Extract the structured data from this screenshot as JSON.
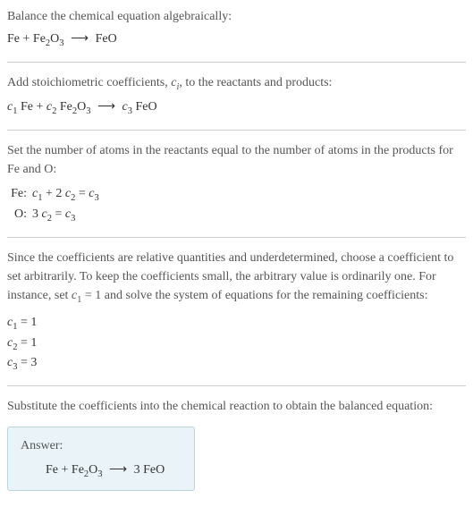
{
  "chart_data": {
    "type": "table",
    "title": "Balance the chemical equation algebraically",
    "reaction_unbalanced": "Fe + Fe2O3 -> FeO",
    "elements": [
      "Fe",
      "O"
    ],
    "coefficients_symbolic": [
      "c1",
      "c2",
      "c3"
    ],
    "atom_balance": {
      "Fe": "c1 + 2 c2 = c3",
      "O": "3 c2 = c3"
    },
    "coefficients_solution": {
      "c1": 1,
      "c2": 1,
      "c3": 3
    },
    "reaction_balanced": "Fe + Fe2O3 -> 3 FeO"
  },
  "section1": {
    "line1": "Balance the chemical equation algebraically:"
  },
  "section2": {
    "line1_a": "Add stoichiometric coefficients, ",
    "line1_b": "c",
    "line1_c": "i",
    "line1_d": ", to the reactants and products:"
  },
  "section3": {
    "line1": "Set the number of atoms in the reactants equal to the number of atoms in the products for Fe and O:",
    "fe_label": "Fe:",
    "o_label": "O:"
  },
  "section4": {
    "line1_a": "Since the coefficients are relative quantities and underdetermined, choose a coefficient to set arbitrarily. To keep the coefficients small, the arbitrary value is ordinarily one. For instance, set ",
    "line1_b": " = 1 and solve the system of equations for the remaining coefficients:"
  },
  "section5": {
    "line1": "Substitute the coefficients into the chemical reaction to obtain the balanced equation:"
  },
  "answer": {
    "label": "Answer:"
  },
  "sym": {
    "c": "c",
    "s1": "1",
    "s2": "2",
    "s3": "3",
    "Fe": "Fe",
    "FeO": "FeO",
    "Fe2O3_a": "Fe",
    "Fe2O3_b": "2",
    "Fe2O3_c": "O",
    "Fe2O3_d": "3",
    "plus": " + ",
    "arrow": "⟶",
    "sp": " ",
    "eq": " = ",
    "two": "2 ",
    "three_sp": "3 ",
    "three": "3",
    "eq1": " = 1",
    "eq3": " = 3",
    "plus2": " + 2 "
  }
}
